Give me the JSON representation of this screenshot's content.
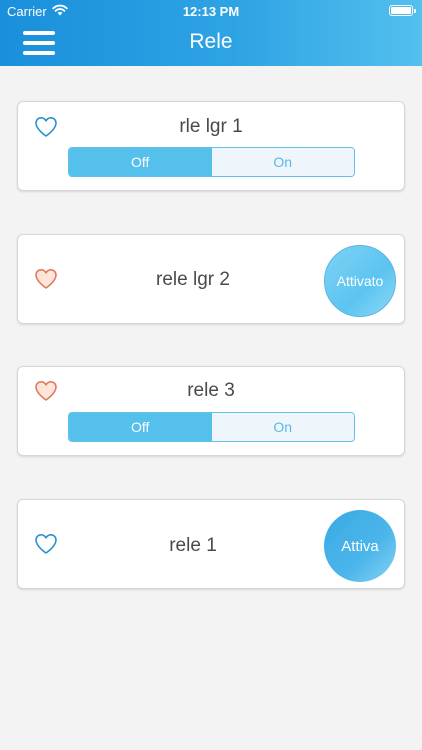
{
  "status_bar": {
    "carrier": "Carrier",
    "time": "12:13 PM"
  },
  "header": {
    "title": "Rele",
    "menu_icon": "hamburger-menu-icon"
  },
  "colors": {
    "accent": "#2ea3e4",
    "heart_blue": "#2a90d0",
    "heart_red": "#e07a5f"
  },
  "relays": [
    {
      "name": "rle lgr 1",
      "favorite": false,
      "control": "toggle",
      "off_label": "Off",
      "on_label": "On",
      "state": "Off"
    },
    {
      "name": "rele lgr 2",
      "favorite": true,
      "control": "button",
      "button_label": "Attivato"
    },
    {
      "name": "rele 3",
      "favorite": true,
      "control": "toggle",
      "off_label": "Off",
      "on_label": "On",
      "state": "Off"
    },
    {
      "name": "rele 1",
      "favorite": false,
      "control": "button",
      "button_label": "Attiva"
    }
  ]
}
